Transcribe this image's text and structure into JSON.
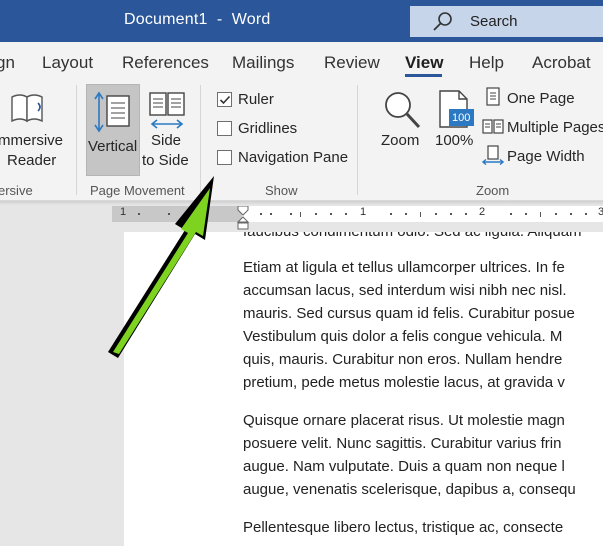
{
  "titlebar": {
    "doc_name": "Document1",
    "separator": "-",
    "app_name": "Word",
    "search_label": "Search"
  },
  "tabs": [
    {
      "label": "gn"
    },
    {
      "label": "Layout"
    },
    {
      "label": "References"
    },
    {
      "label": "Mailings"
    },
    {
      "label": "Review"
    },
    {
      "label": "View",
      "active": true
    },
    {
      "label": "Help"
    },
    {
      "label": "Acrobat"
    }
  ],
  "ribbon": {
    "immersive": {
      "button_line1": "mmersive",
      "button_line2": "Reader",
      "group": "ersive"
    },
    "page_movement": {
      "vertical": "Vertical",
      "side_line1": "Side",
      "side_line2": "to Side",
      "group": "Page Movement"
    },
    "show": {
      "ruler": {
        "label": "Ruler",
        "checked": true
      },
      "gridlines": {
        "label": "Gridlines",
        "checked": false
      },
      "navigation_pane": {
        "label": "Navigation Pane",
        "checked": false
      },
      "group": "Show"
    },
    "zoom": {
      "zoom_label": "Zoom",
      "pct_label": "100%",
      "pct_icon_value": "100",
      "one_page": "One Page",
      "multiple_pages": "Multiple Pages",
      "page_width": "Page Width",
      "group": "Zoom"
    }
  },
  "ruler": {
    "numbers": [
      "1",
      "1",
      "2",
      "3"
    ]
  },
  "document": {
    "paragraphs": [
      "faucibus condimentum odio. Sed ac ligula. Aliquam",
      "Etiam at ligula et tellus ullamcorper ultrices. In fe",
      "accumsan lacus, sed interdum wisi nibh nec nisl.",
      "mauris. Sed cursus quam id felis. Curabitur posue",
      "Vestibulum quis dolor a felis congue vehicula. M",
      "quis, mauris. Curabitur non eros. Nullam hendre",
      "pretium, pede metus molestie lacus, at gravida v",
      "Quisque ornare placerat risus. Ut molestie magn",
      "posuere velit. Nunc sagittis. Curabitur varius frin",
      "augue. Nam vulputate. Duis a quam non neque l",
      "augue, venenatis scelerisque, dapibus a, consequ",
      "Pellentesque libero lectus, tristique ac, consecte"
    ]
  },
  "colors": {
    "title_bar": "#2b579a",
    "annotation_arrow": "#7ed321"
  }
}
